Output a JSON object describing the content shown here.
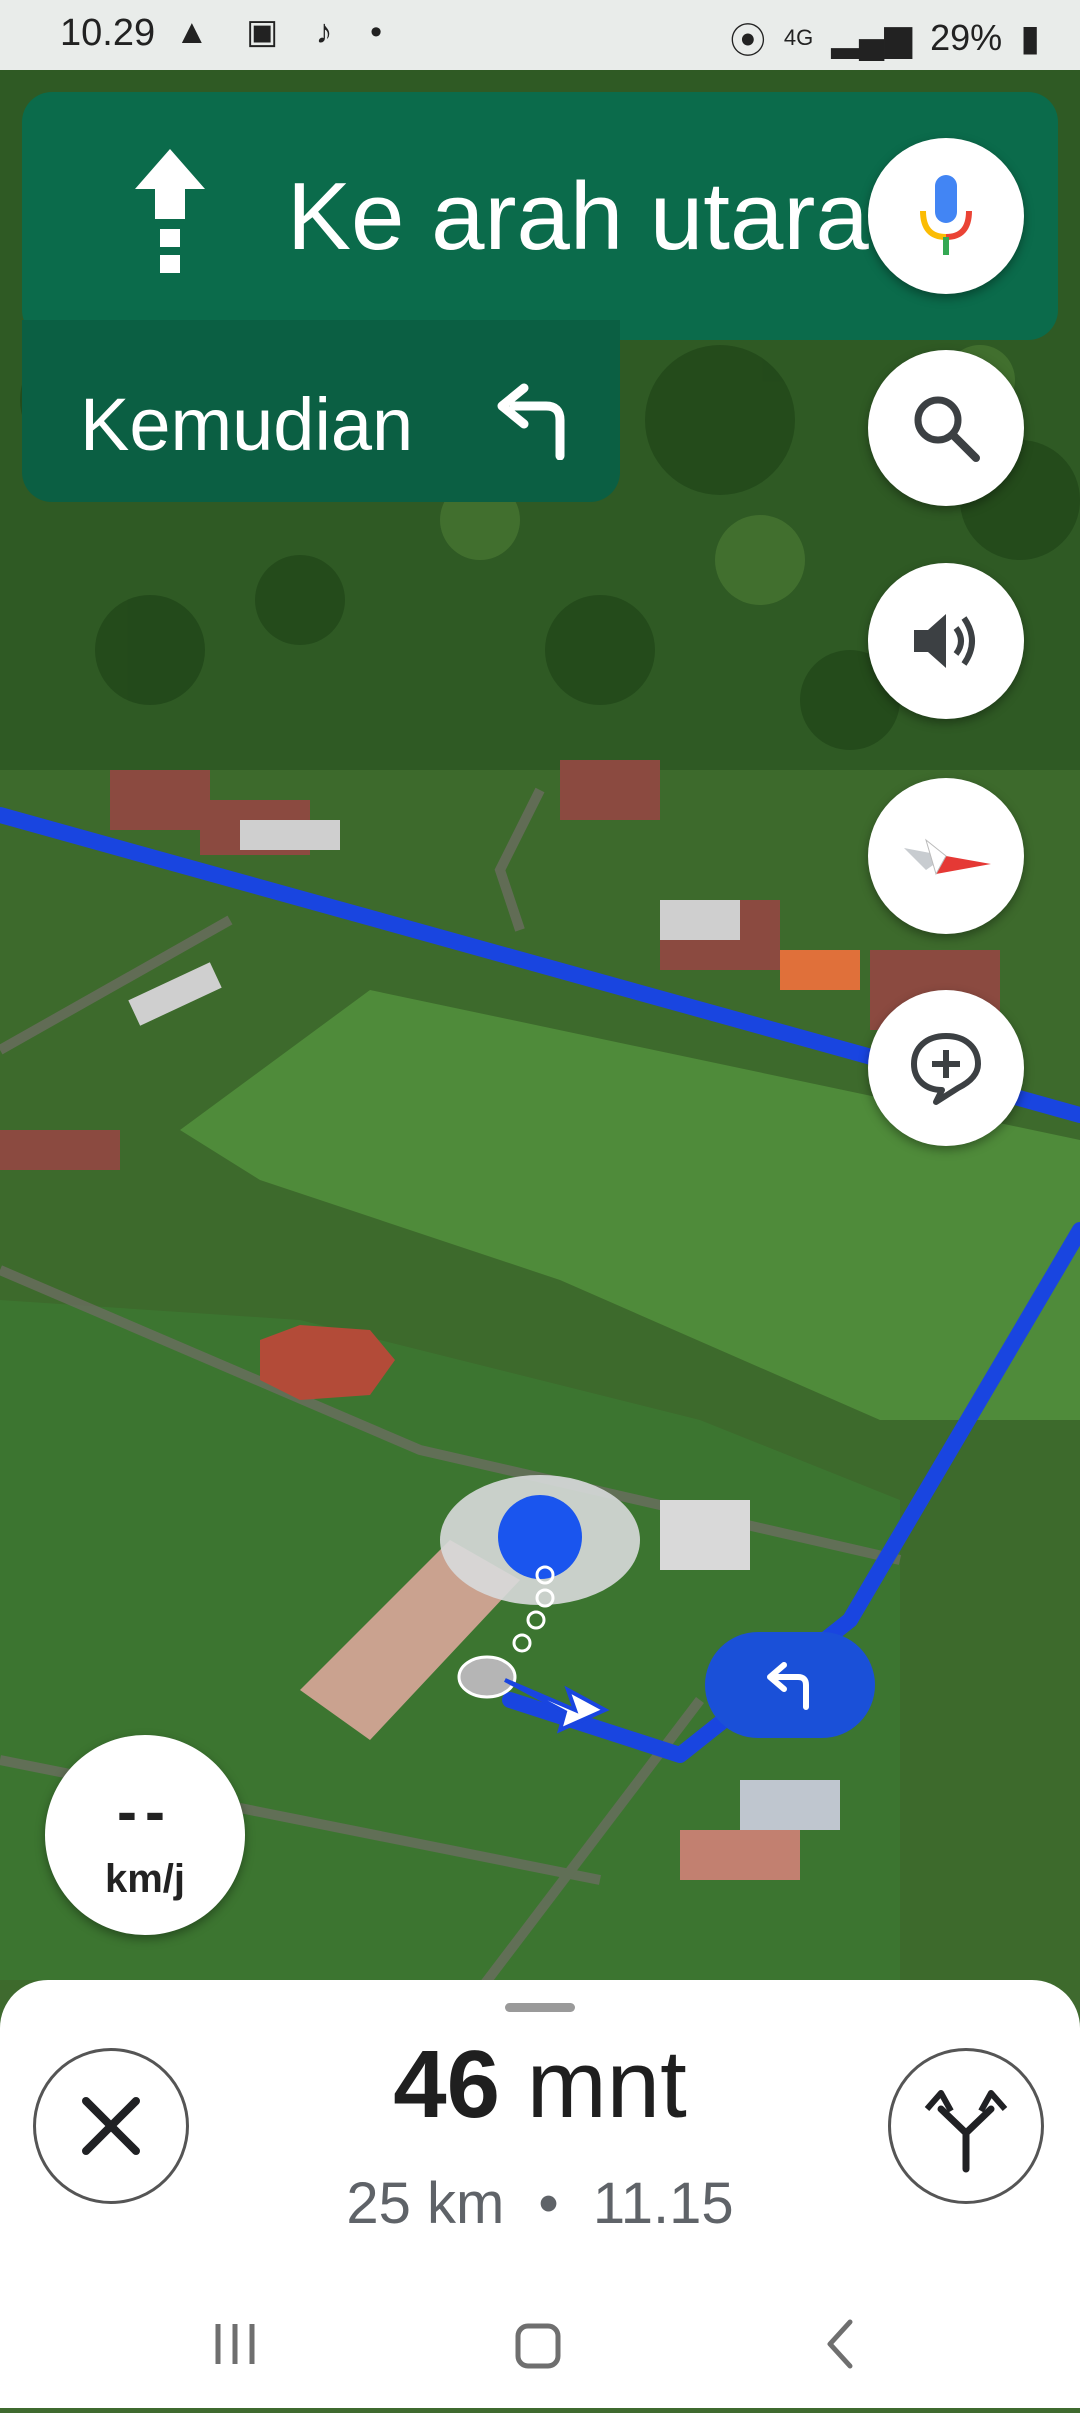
{
  "status_bar": {
    "time": "10.29",
    "battery": "29%",
    "network": "4G"
  },
  "navigation": {
    "direction_text": "Ke arah utara",
    "next_label": "Kemudian"
  },
  "speed": {
    "value": "--",
    "unit": "km/j"
  },
  "trip": {
    "duration_value": "46",
    "duration_unit": "mnt",
    "distance": "25 km",
    "separator": "•",
    "arrival_time": "11.15"
  },
  "icons": {
    "direction": "straight-arrow-icon",
    "next_turn": "turn-left-icon",
    "mic": "mic-icon",
    "search": "search-icon",
    "sound": "sound-icon",
    "compass": "compass-icon",
    "report": "add-report-icon",
    "close": "close-icon",
    "routes": "alternate-routes-icon"
  },
  "colors": {
    "nav_green": "#0b6b4b",
    "route_blue": "#1a50d8"
  }
}
